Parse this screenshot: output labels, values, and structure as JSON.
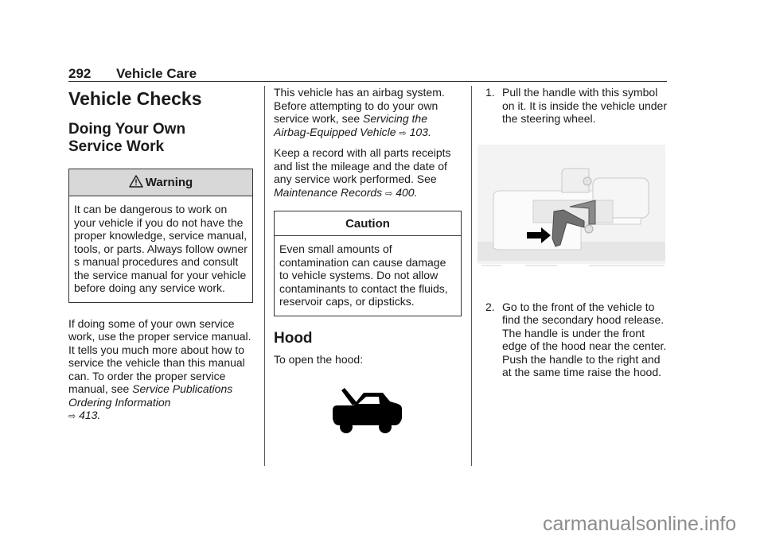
{
  "header": {
    "page_number": "292",
    "section": "Vehicle Care"
  },
  "column1": {
    "title": "Vehicle Checks",
    "subtitle_line1": "Doing Your Own",
    "subtitle_line2": "Service Work",
    "warning": {
      "icon": "warning-triangle-icon",
      "label": "Warning",
      "text": "It can be dangerous to work on your vehicle if you do not have the proper knowledge, service manual, tools, or parts. Always follow owner s manual procedures and consult the service manual for your vehicle before doing any service work."
    },
    "paragraph": {
      "text": "If doing some of your own service work, use the proper service manual. It tells you much more about how to service the vehicle than this manual can. To order the proper service manual, see ",
      "ref_title": "Service Publications Ordering Information",
      "ref_arrow": "⇨",
      "ref_page": "413."
    }
  },
  "column2": {
    "para1": {
      "text": "This vehicle has an airbag system. Before attempting to do your own service work, see ",
      "ref_title": "Servicing the Airbag-Equipped Vehicle",
      "ref_arrow": "⇨",
      "ref_page": "103."
    },
    "para2": {
      "text": "Keep a record with all parts receipts and list the mileage and the date of any service work performed. See ",
      "ref_title": "Maintenance Records",
      "ref_arrow": "⇨",
      "ref_page": "400."
    },
    "caution": {
      "label": "Caution",
      "text": "Even small amounts of contamination can cause damage to vehicle systems. Do not allow contaminants to contact the fluids, reservoir caps, or dipsticks."
    },
    "hood_heading": "Hood",
    "hood_intro": "To open the hood:",
    "hood_symbol": "hood-open-car-icon"
  },
  "column3": {
    "steps": [
      {
        "num": "1.",
        "text": "Pull the handle with this symbol on it. It is inside the vehicle under the steering wheel."
      },
      {
        "num": "2.",
        "text": "Go to the front of the vehicle to find the secondary hood release. The handle is under the front edge of the hood near the center. Push the handle to the right and at the same time raise the hood."
      }
    ],
    "illustration": "hood-release-handle-illustration"
  },
  "watermark": "carmanualsonline.info"
}
